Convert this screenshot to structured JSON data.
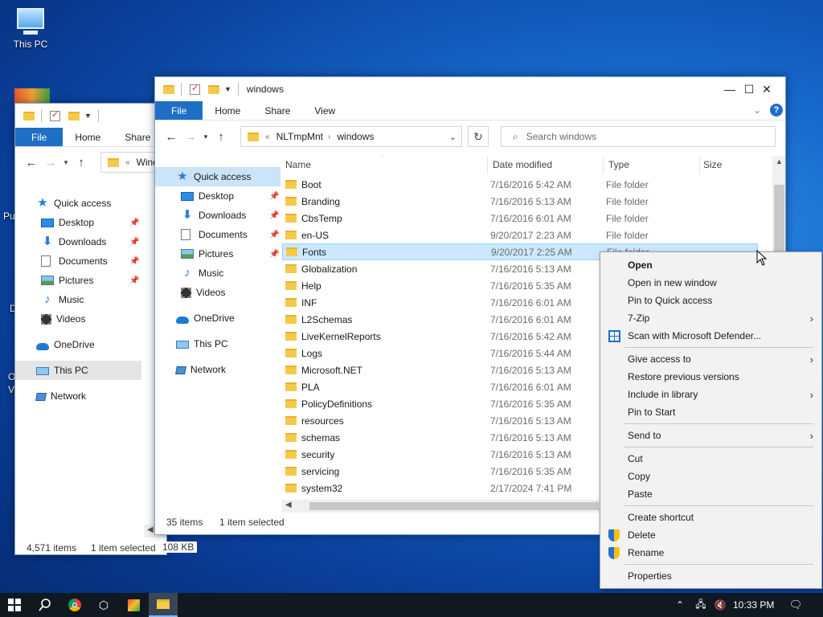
{
  "desktop": {
    "icons": [
      {
        "label": "This PC"
      }
    ],
    "partial_labels": [
      "Pu",
      "D",
      "O",
      "V"
    ]
  },
  "back_window": {
    "ribbon": {
      "file": "File",
      "home": "Home",
      "share": "Share"
    },
    "address_crumb": "Wind",
    "nav": [
      {
        "label": "Quick access",
        "icon": "star-icon"
      },
      {
        "label": "Desktop",
        "icon": "desktop-icon",
        "pinned": true
      },
      {
        "label": "Downloads",
        "icon": "download-icon",
        "pinned": true
      },
      {
        "label": "Documents",
        "icon": "documents-icon",
        "pinned": true
      },
      {
        "label": "Pictures",
        "icon": "pictures-icon",
        "pinned": true
      },
      {
        "label": "Music",
        "icon": "music-icon"
      },
      {
        "label": "Videos",
        "icon": "videos-icon"
      },
      {
        "label": "OneDrive",
        "icon": "onedrive-icon"
      },
      {
        "label": "This PC",
        "icon": "this-pc-icon"
      },
      {
        "label": "Network",
        "icon": "network-icon"
      }
    ],
    "status": {
      "items": "4,571 items",
      "selected": "1 item selected",
      "size": "108 KB"
    }
  },
  "front_window": {
    "title": "windows",
    "ribbon": {
      "file": "File",
      "home": "Home",
      "share": "Share",
      "view": "View"
    },
    "breadcrumb": [
      "NLTmpMnt",
      "windows"
    ],
    "search_placeholder": "Search windows",
    "nav": [
      {
        "label": "Quick access",
        "icon": "star-icon"
      },
      {
        "label": "Desktop",
        "icon": "desktop-icon",
        "pinned": true
      },
      {
        "label": "Downloads",
        "icon": "download-icon",
        "pinned": true
      },
      {
        "label": "Documents",
        "icon": "documents-icon",
        "pinned": true
      },
      {
        "label": "Pictures",
        "icon": "pictures-icon",
        "pinned": true
      },
      {
        "label": "Music",
        "icon": "music-icon"
      },
      {
        "label": "Videos",
        "icon": "videos-icon"
      },
      {
        "label": "OneDrive",
        "icon": "onedrive-icon"
      },
      {
        "label": "This PC",
        "icon": "this-pc-icon"
      },
      {
        "label": "Network",
        "icon": "network-icon"
      }
    ],
    "columns": {
      "name": "Name",
      "date": "Date modified",
      "type": "Type",
      "size": "Size"
    },
    "files": [
      {
        "name": "Boot",
        "date": "7/16/2016 5:42 AM",
        "type": "File folder"
      },
      {
        "name": "Branding",
        "date": "7/16/2016 5:13 AM",
        "type": "File folder"
      },
      {
        "name": "CbsTemp",
        "date": "7/16/2016 6:01 AM",
        "type": "File folder"
      },
      {
        "name": "en-US",
        "date": "9/20/2017 2:23 AM",
        "type": "File folder"
      },
      {
        "name": "Fonts",
        "date": "9/20/2017 2:25 AM",
        "type": "File folder",
        "selected": true
      },
      {
        "name": "Globalization",
        "date": "7/16/2016 5:13 AM",
        "type": ""
      },
      {
        "name": "Help",
        "date": "7/16/2016 5:35 AM",
        "type": ""
      },
      {
        "name": "INF",
        "date": "7/16/2016 6:01 AM",
        "type": ""
      },
      {
        "name": "L2Schemas",
        "date": "7/16/2016 6:01 AM",
        "type": ""
      },
      {
        "name": "LiveKernelReports",
        "date": "7/16/2016 5:42 AM",
        "type": ""
      },
      {
        "name": "Logs",
        "date": "7/16/2016 5:44 AM",
        "type": ""
      },
      {
        "name": "Microsoft.NET",
        "date": "7/16/2016 5:13 AM",
        "type": ""
      },
      {
        "name": "PLA",
        "date": "7/16/2016 6:01 AM",
        "type": ""
      },
      {
        "name": "PolicyDefinitions",
        "date": "7/16/2016 5:35 AM",
        "type": ""
      },
      {
        "name": "resources",
        "date": "7/16/2016 5:13 AM",
        "type": ""
      },
      {
        "name": "schemas",
        "date": "7/16/2016 5:13 AM",
        "type": ""
      },
      {
        "name": "security",
        "date": "7/16/2016 5:13 AM",
        "type": ""
      },
      {
        "name": "servicing",
        "date": "7/16/2016 5:35 AM",
        "type": ""
      },
      {
        "name": "system32",
        "date": "2/17/2024 7:41 PM",
        "type": ""
      }
    ],
    "status": {
      "items": "35 items",
      "selected": "1 item selected"
    }
  },
  "context_menu": {
    "groups": [
      [
        {
          "label": "Open",
          "bold": true
        },
        {
          "label": "Open in new window"
        },
        {
          "label": "Pin to Quick access"
        },
        {
          "label": "7-Zip",
          "submenu": true
        },
        {
          "label": "Scan with Microsoft Defender...",
          "icon": "defender-icon"
        }
      ],
      [
        {
          "label": "Give access to",
          "submenu": true
        },
        {
          "label": "Restore previous versions"
        },
        {
          "label": "Include in library",
          "submenu": true
        },
        {
          "label": "Pin to Start"
        }
      ],
      [
        {
          "label": "Send to",
          "submenu": true
        }
      ],
      [
        {
          "label": "Cut"
        },
        {
          "label": "Copy"
        },
        {
          "label": "Paste"
        }
      ],
      [
        {
          "label": "Create shortcut"
        },
        {
          "label": "Delete",
          "icon": "shield-icon"
        },
        {
          "label": "Rename",
          "icon": "shield-icon"
        }
      ],
      [
        {
          "label": "Properties"
        }
      ]
    ]
  },
  "taskbar": {
    "clock": "10:33 PM"
  },
  "colors": {
    "accent": "#1f6fc5",
    "selection": "#cce8ff",
    "taskbar": "#101820"
  }
}
